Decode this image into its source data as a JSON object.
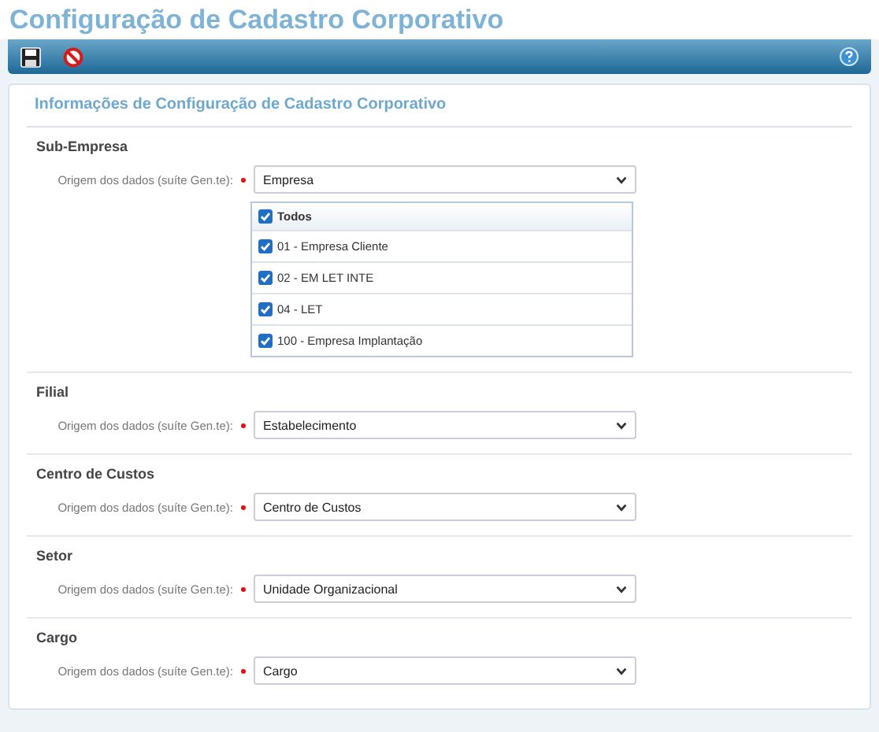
{
  "page_title": "Configuração de Cadastro Corporativo",
  "panel_title": "Informações de Configuração de Cadastro Corporativo",
  "sections": [
    {
      "heading": "Sub-Empresa",
      "label": "Origem dos dados (suíte Gen.te):",
      "required": true,
      "value": "Empresa",
      "checklist": {
        "all": {
          "label": "Todos",
          "checked": true
        },
        "items": [
          {
            "label": "01 - Empresa Cliente",
            "checked": true
          },
          {
            "label": "02 - EM LET INTE",
            "checked": true
          },
          {
            "label": "04 - LET",
            "checked": true
          },
          {
            "label": "100 - Empresa Implantação",
            "checked": true
          }
        ]
      }
    },
    {
      "heading": "Filial",
      "label": "Origem dos dados (suíte Gen.te):",
      "required": true,
      "value": "Estabelecimento"
    },
    {
      "heading": "Centro de Custos",
      "label": "Origem dos dados (suíte Gen.te):",
      "required": true,
      "value": "Centro de Custos"
    },
    {
      "heading": "Setor",
      "label": "Origem dos dados (suíte Gen.te):",
      "required": true,
      "value": "Unidade Organizacional"
    },
    {
      "heading": "Cargo",
      "label": "Origem dos dados (suíte Gen.te):",
      "required": true,
      "value": "Cargo"
    }
  ]
}
